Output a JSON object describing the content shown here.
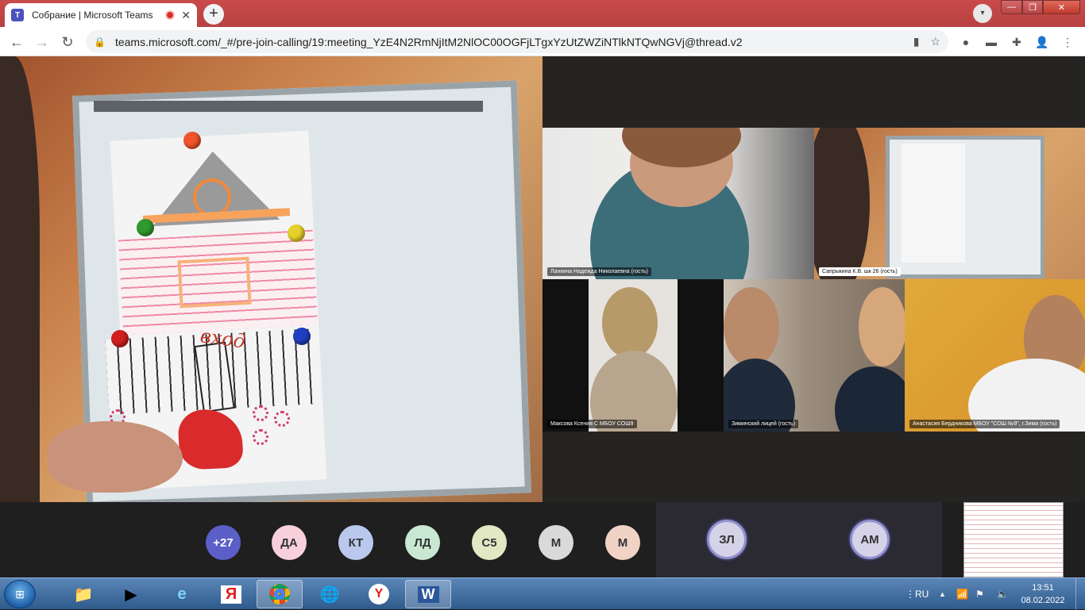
{
  "browser": {
    "tab_title": "Собрание | Microsoft Teams",
    "tab_favicon": "T",
    "new_tab": "+",
    "tab_close": "✕",
    "url": "teams.microsoft.com/_#/pre-join-calling/19:meeting_YzE4N2RmNjItM2NlOC00OGFjLTgxYzUtZWZiNTlkNTQwNGVj@thread.v2"
  },
  "meeting": {
    "main_video_handwriting": "вход",
    "participants": [
      {
        "name": "Ланкина Надежда Николаевна (гость)"
      },
      {
        "name": "Сапрыкина К.В. шк 26 (гость)"
      },
      {
        "name": "Максова Ксения С МБОУ СОШ9"
      },
      {
        "name": "Зиминский лицей (гость)"
      },
      {
        "name": "Анастасия Бердникова МБОУ \"СОШ №9\", г.Зима (гость)"
      }
    ],
    "avatars": [
      "+27",
      "ДА",
      "КТ",
      "ЛД",
      "С5",
      "М",
      "М"
    ],
    "ring_avatars": [
      "ЗЛ",
      "АМ"
    ]
  },
  "taskbar": {
    "apps": [
      "explorer-icon",
      "media-player-icon",
      "internet-explorer-icon",
      "yandex-icon",
      "chrome-icon",
      "browser-globe-icon",
      "yandex-browser-icon",
      "word-icon"
    ],
    "lang": "RU",
    "time": "13:51",
    "date": "08.02.2022"
  },
  "colors": {
    "tabstrip": "#b84141",
    "teams_purple": "#5b5fc7",
    "taskbar": "#2e5a8c"
  }
}
